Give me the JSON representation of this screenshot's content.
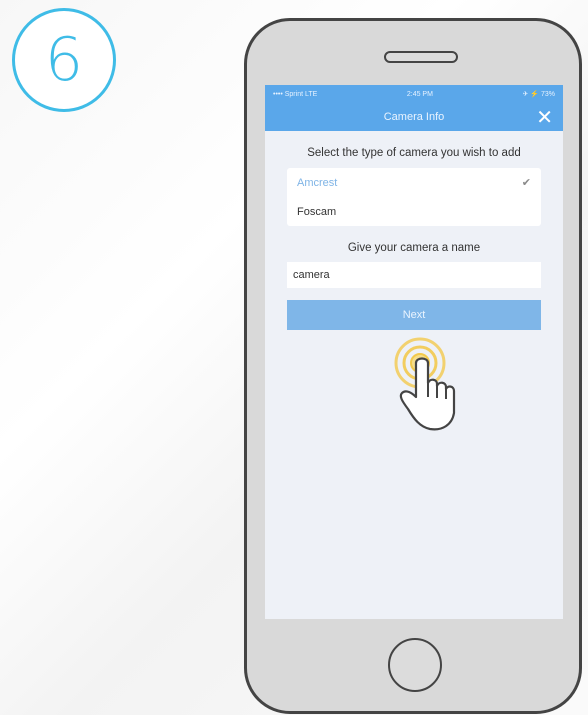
{
  "step_number": "6",
  "status_bar": {
    "carrier": "•••• Sprint LTE",
    "time": "2:45 PM",
    "battery": "✈ ⚡ 73%"
  },
  "nav": {
    "title": "Camera Info",
    "close_icon": "close-icon"
  },
  "camera_type": {
    "prompt": "Select the type of camera you wish to add",
    "options": [
      {
        "label": "Amcrest",
        "selected": true
      },
      {
        "label": "Foscam",
        "selected": false
      }
    ]
  },
  "camera_name": {
    "label": "Give your camera a name",
    "value": "camera"
  },
  "next_button": {
    "label": "Next"
  },
  "colors": {
    "accent": "#5aa7ea",
    "badge": "#3fbce7",
    "button": "#7fb6e8",
    "tap_ring": "#f2c94c"
  }
}
